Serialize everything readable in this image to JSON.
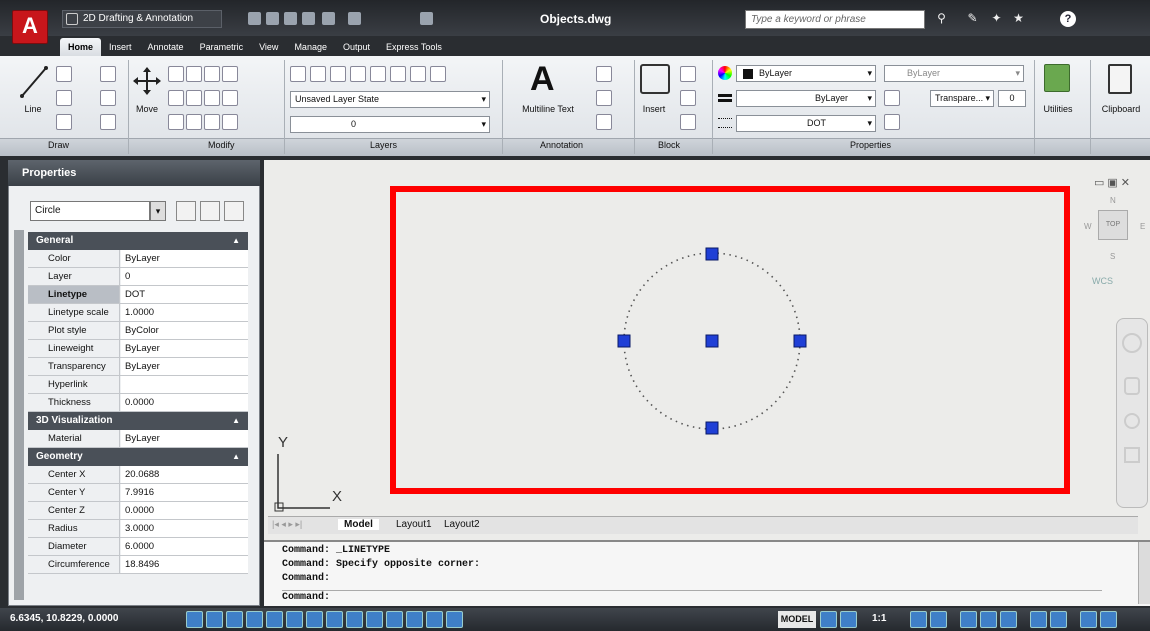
{
  "title_bar": {
    "workspace": "2D Drafting & Annotation",
    "document_title": "Objects.dwg",
    "search_placeholder": "Type a keyword or phrase",
    "app_letter": "A"
  },
  "ribbon_tabs": [
    "Home",
    "Insert",
    "Annotate",
    "Parametric",
    "View",
    "Manage",
    "Output",
    "Express Tools"
  ],
  "ribbon": {
    "draw": {
      "title": "Draw",
      "line_label": "Line"
    },
    "modify": {
      "title": "Modify",
      "move_label": "Move"
    },
    "layers": {
      "title": "Layers",
      "layer_state": "Unsaved Layer State",
      "current_layer": "0"
    },
    "annotation": {
      "title": "Annotation",
      "mtext_label": "Multiline Text",
      "mtext_glyph": "A"
    },
    "block": {
      "title": "Block",
      "insert_label": "Insert"
    },
    "properties": {
      "title": "Properties",
      "color": "ByLayer",
      "lineweight": "ByLayer",
      "linetype": "DOT",
      "plot_style": "ByLayer",
      "transparency_label": "Transpare...",
      "transparency_value": "0"
    },
    "utilities": {
      "label": "Utilities"
    },
    "clipboard": {
      "label": "Clipboard"
    }
  },
  "properties_palette": {
    "title": "Properties",
    "object_type": "Circle",
    "sections": {
      "general": {
        "title": "General",
        "rows": [
          {
            "k": "Color",
            "v": "ByLayer"
          },
          {
            "k": "Layer",
            "v": "0"
          },
          {
            "k": "Linetype",
            "v": "DOT"
          },
          {
            "k": "Linetype scale",
            "v": "1.0000"
          },
          {
            "k": "Plot style",
            "v": "ByColor"
          },
          {
            "k": "Lineweight",
            "v": "ByLayer"
          },
          {
            "k": "Transparency",
            "v": "ByLayer"
          },
          {
            "k": "Hyperlink",
            "v": ""
          },
          {
            "k": "Thickness",
            "v": "0.0000"
          }
        ]
      },
      "viz3d": {
        "title": "3D Visualization",
        "rows": [
          {
            "k": "Material",
            "v": "ByLayer"
          }
        ]
      },
      "geometry": {
        "title": "Geometry",
        "rows": [
          {
            "k": "Center X",
            "v": "20.0688"
          },
          {
            "k": "Center Y",
            "v": "7.9916"
          },
          {
            "k": "Center Z",
            "v": "0.0000"
          },
          {
            "k": "Radius",
            "v": "3.0000"
          },
          {
            "k": "Diameter",
            "v": "6.0000"
          },
          {
            "k": "Circumference",
            "v": "18.8496"
          }
        ]
      }
    }
  },
  "viewport": {
    "ucs_x": "X",
    "ucs_y": "Y",
    "wcs_label": "WCS",
    "viewcube_top": "TOP",
    "compass_w": "W",
    "compass_e": "E",
    "compass_n": "N",
    "compass_s": "S"
  },
  "layout_tabs": [
    "Model",
    "Layout1",
    "Layout2"
  ],
  "command_lines": [
    "Command:  _LINETYPE",
    "Command:  Specify opposite corner:",
    "Command:",
    "Command:"
  ],
  "status_bar": {
    "coords": "6.6345, 10.8229, 0.0000",
    "model_label": "MODEL",
    "scale_label": "1:1"
  },
  "colors": {
    "highlight_box": "#ff0000",
    "grip": "#1f3fd6"
  }
}
